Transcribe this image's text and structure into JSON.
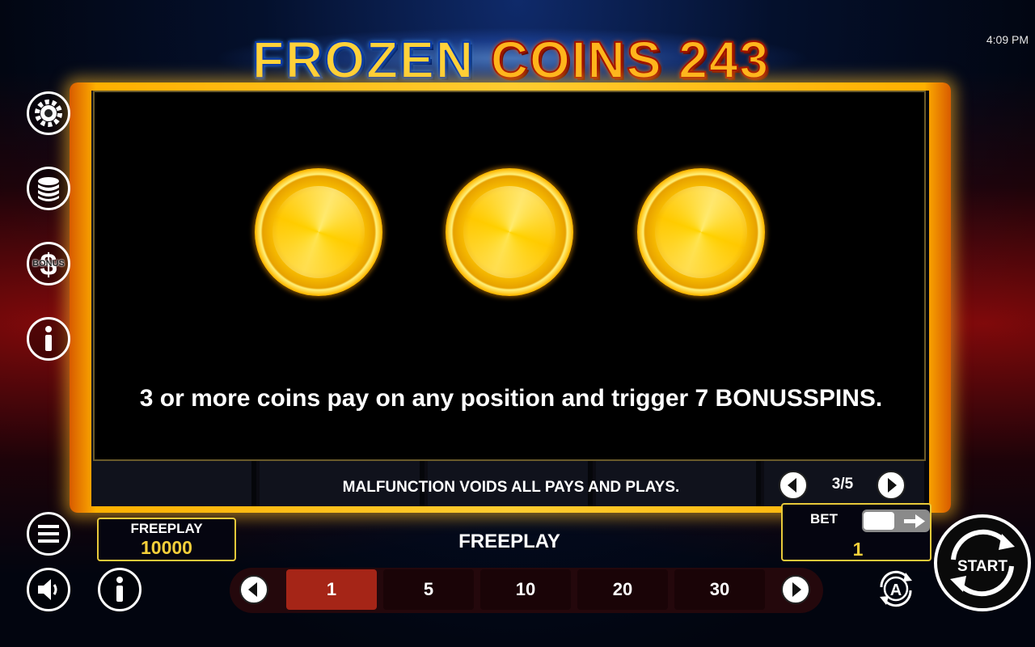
{
  "status_bar": {
    "time": "4:09 PM"
  },
  "game": {
    "title_part1": "FROZEN",
    "title_part2": "COINS 243"
  },
  "paytable": {
    "description": "3 or more coins pay on any position and trigger 7 BONUSSPINS.",
    "symbols": [
      "coin-icon",
      "coin-icon",
      "coin-icon"
    ],
    "page_indicator": "3/5"
  },
  "notice": "MALFUNCTION VOIDS ALL PAYS AND PLAYS.",
  "side_menu": {
    "items": [
      "gear-icon",
      "coins-stack-icon",
      "bonus-dollar-icon",
      "info-icon"
    ],
    "bonus_label": "BONUS"
  },
  "bottom": {
    "freeplay_label": "FREEPLAY",
    "freeplay_value": "10000",
    "center_label": "FREEPLAY",
    "bet_label": "BET",
    "bet_value": "1",
    "start_label": "START",
    "bet_options": [
      "1",
      "5",
      "10",
      "20",
      "30"
    ],
    "selected_bet": "1"
  },
  "colors": {
    "frame_gold": "#ffcc30",
    "value_yellow": "#f4cf3a",
    "active_chip": "#a52517",
    "inactive_chip": "#1a0407"
  }
}
